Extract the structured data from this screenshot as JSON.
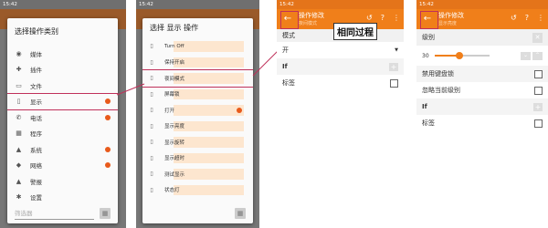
{
  "status": {
    "time1": "15:42",
    "time2": "15:42",
    "time3": "15:42",
    "time4": "15:42"
  },
  "dialog1": {
    "title": "选择操作类别",
    "items": [
      {
        "icon": "camera-icon",
        "glyph": "◉",
        "label": "媒体",
        "badge": false
      },
      {
        "icon": "plugin-icon",
        "glyph": "✚",
        "label": "插件",
        "badge": false
      },
      {
        "icon": "folder-icon",
        "glyph": "▭",
        "label": "文件",
        "badge": false
      },
      {
        "icon": "phone-display-icon",
        "glyph": "▯",
        "label": "显示",
        "badge": true,
        "selected": true
      },
      {
        "icon": "call-icon",
        "glyph": "✆",
        "label": "电话",
        "badge": true
      },
      {
        "icon": "apps-icon",
        "glyph": "▦",
        "label": "程序",
        "badge": false
      },
      {
        "icon": "android-icon",
        "glyph": "▲",
        "label": "系统",
        "badge": true
      },
      {
        "icon": "network-icon",
        "glyph": "◆",
        "label": "网络",
        "badge": true
      },
      {
        "icon": "alert-icon",
        "glyph": "▲",
        "label": "警报",
        "badge": false
      },
      {
        "icon": "settings-icon",
        "glyph": "✱",
        "label": "设置",
        "badge": false
      }
    ],
    "filter_placeholder": "筛选器"
  },
  "dialog2": {
    "title": "选择 显示 操作",
    "items": [
      {
        "label": "Turn Off",
        "badge": false
      },
      {
        "label": "保持开启",
        "badge": false
      },
      {
        "label": "夜间模式",
        "badge": false,
        "selected": true
      },
      {
        "label": "屏幕锁",
        "badge": false
      },
      {
        "label": "打开",
        "badge": true
      },
      {
        "label": "显示亮度",
        "badge": false
      },
      {
        "label": "显示旋转",
        "badge": false
      },
      {
        "label": "显示超时",
        "badge": false
      },
      {
        "label": "测试显示",
        "badge": false
      },
      {
        "label": "状态灯",
        "badge": false
      }
    ]
  },
  "screen3": {
    "title": "操作修改",
    "subtitle": "夜间模式",
    "callout": "相同过程",
    "mode_label": "模式",
    "mode_value": "开",
    "if_label": "If",
    "tag_label": "标签"
  },
  "screen4": {
    "title": "操作修改",
    "subtitle": "显示亮度",
    "level_label": "级别",
    "level_value": "30",
    "slider_fraction": 0.45,
    "lock_label": "禁用键盘锁",
    "ignore_label": "忽略当前级别",
    "if_label": "If",
    "tag_label": "标签"
  },
  "colors": {
    "accent": "#f07f1a",
    "highlight": "#c0305a",
    "badge": "#e85a1b"
  }
}
